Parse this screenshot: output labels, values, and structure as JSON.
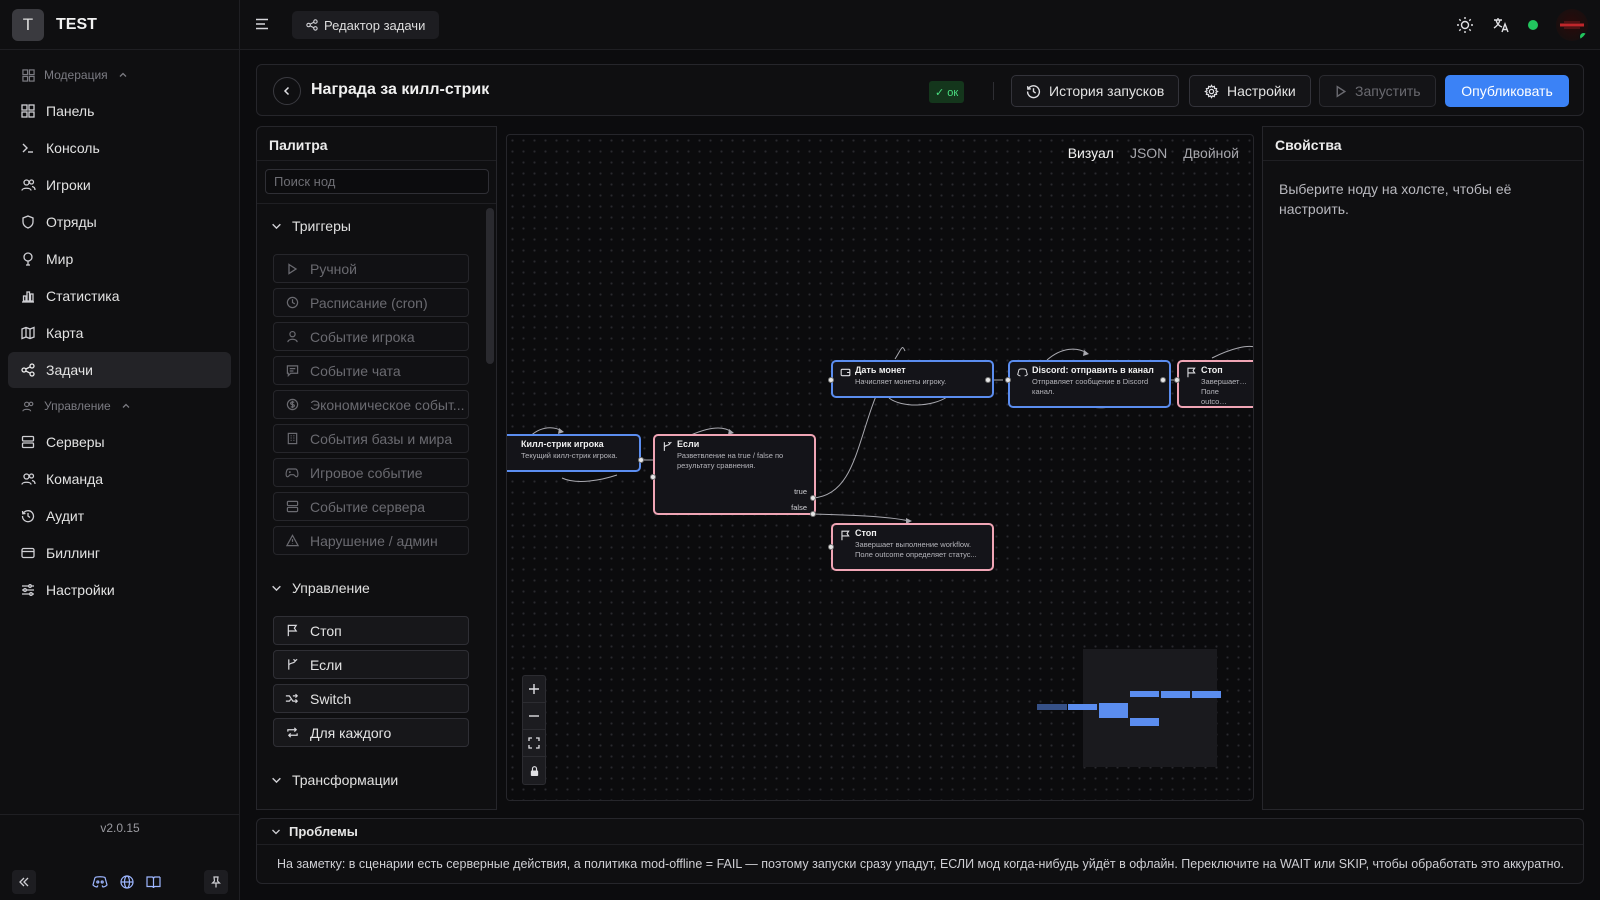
{
  "app": {
    "logo_letter": "T",
    "name": "TEST",
    "version": "v2.0.15"
  },
  "sidebar": {
    "groups": [
      {
        "label": "Модерация",
        "items": [
          "Панель",
          "Консоль",
          "Игроки",
          "Отряды",
          "Мир",
          "Статистика",
          "Карта",
          "Задачи"
        ]
      },
      {
        "label": "Управление",
        "items": [
          "Серверы",
          "Команда",
          "Аудит",
          "Биллинг",
          "Настройки"
        ]
      }
    ],
    "active_item": "Задачи"
  },
  "topbar": {
    "breadcrumb": "Редактор задачи"
  },
  "editor": {
    "title": "Награда за килл-стрик",
    "status_badge": "✓ ок",
    "history_button": "История запусков",
    "settings_button": "Настройки",
    "run_button": "Запустить",
    "publish_button": "Опубликовать",
    "accent_color": "#3b82f6"
  },
  "palette": {
    "title": "Палитра",
    "search_placeholder": "Поиск нод",
    "sections": [
      {
        "label": "Триггеры",
        "items": [
          "Ручной",
          "Расписание (cron)",
          "Событие игрока",
          "Событие чата",
          "Экономическое событ...",
          "События базы и мира",
          "Игровое событие",
          "Событие сервера",
          "Нарушение / админ"
        ]
      },
      {
        "label": "Управление",
        "items": [
          "Стоп",
          "Если",
          "Switch",
          "Для каждого"
        ]
      },
      {
        "label": "Трансформации",
        "items": []
      }
    ]
  },
  "canvas": {
    "view_tabs": [
      "Визуал",
      "JSON",
      "Двойной"
    ],
    "active_view": "Визуал",
    "nodes": {
      "killstreak": {
        "title": "Килл-стрик игрока",
        "desc": "Текущий килл-стрик игрока."
      },
      "if": {
        "title": "Если",
        "desc": "Разветвление на true / false по результату сравнения.",
        "true_label": "true",
        "false_label": "false"
      },
      "coins": {
        "title": "Дать монет",
        "desc": "Начисляет монеты игроку."
      },
      "discord": {
        "title": "Discord: отправить в канал",
        "desc": "Отправляет сообщение в Discord канал."
      },
      "stop_right": {
        "title": "Стоп",
        "desc": "Завершает… Поле outco…"
      },
      "stop": {
        "title": "Стоп",
        "desc": "Завершает выполнение workflow. Поле outcome определяет статус..."
      }
    }
  },
  "properties": {
    "title": "Свойства",
    "hint": "Выберите ноду на холсте, чтобы её настроить."
  },
  "problems": {
    "title": "Проблемы",
    "message": "На заметку: в сценарии есть серверные действия, а политика mod-offline = FAIL — поэтому запуски сразу упадут, ЕСЛИ мод когда-нибудь уйдёт в офлайн. Переключите на WAIT или SKIP, чтобы обработать это аккуратно."
  }
}
